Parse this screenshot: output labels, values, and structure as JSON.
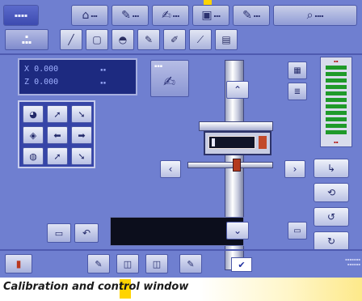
{
  "caption": "Calibration and control window",
  "top_tabs": [
    {
      "icon": "home-icon",
      "glyph": "⌂"
    },
    {
      "icon": "pen-icon",
      "glyph": "✎"
    },
    {
      "icon": "plot-icon",
      "glyph": "✍"
    },
    {
      "icon": "monitor-icon",
      "glyph": "▣"
    },
    {
      "icon": "pen-icon",
      "glyph": "✎"
    },
    {
      "icon": "search-icon",
      "glyph": "⌕"
    }
  ],
  "tool_row": [
    {
      "icon": "line-icon",
      "glyph": "╱"
    },
    {
      "icon": "frame-icon",
      "glyph": "▢"
    },
    {
      "icon": "stamp-icon",
      "glyph": "◓"
    },
    {
      "icon": "pen-icon",
      "glyph": "✎"
    },
    {
      "icon": "pen-icon",
      "glyph": "✐"
    },
    {
      "icon": "line-icon",
      "glyph": "⟋"
    },
    {
      "icon": "scanner-icon",
      "glyph": "▤"
    }
  ],
  "readout": {
    "x_label": "X",
    "x_value": "0.000",
    "z_label": "Z",
    "z_value": "0.000"
  },
  "move_grid": [
    "◕",
    "➚",
    "➘",
    "◈",
    "⬅",
    "➡",
    "◍",
    "➚",
    "➘"
  ],
  "arrows": {
    "left": "‹",
    "right": "›",
    "up": "⌃",
    "down": "⌄"
  },
  "right_tools": [
    "↳",
    "⟲",
    "↺",
    "↻"
  ],
  "undo": {
    "a": "▭",
    "b": "↶"
  },
  "bottom_buttons": [
    "✎",
    "◫",
    "◫",
    "✎"
  ],
  "exit": "▮",
  "check": "✔",
  "colors": {
    "screen_bg": "#6f7fd0",
    "panel_dark": "#1d2a80",
    "meter_green": "#1f9a2a",
    "probe_red": "#b43a1e",
    "highlight_yellow": "#ffd400"
  }
}
